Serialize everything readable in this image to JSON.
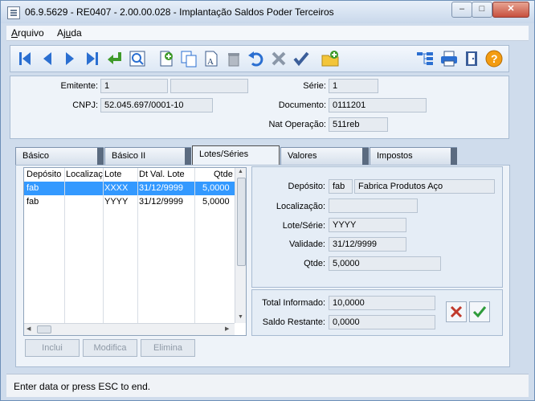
{
  "window": {
    "title": "06.9.5629 - RE0407 - 2.00.00.028 - Implantação Saldos Poder Terceiros",
    "controls": {
      "minimize": "–",
      "maximize": "□",
      "close": "✕"
    }
  },
  "menu": {
    "items": [
      {
        "u": "A",
        "rest": "rquivo"
      },
      {
        "pre": "Aj",
        "u": "u",
        "rest": "da"
      }
    ]
  },
  "toolbar": {
    "buttons": [
      "first-icon",
      "previous-icon",
      "next-icon",
      "last-icon",
      "goto-icon",
      "search-icon",
      "add-icon",
      "copy-icon",
      "edit-icon",
      "delete-icon",
      "undo-icon",
      "cancel-icon",
      "save-icon",
      "new-folder-icon",
      "hierarchy-icon",
      "print-icon",
      "exit-icon",
      "help-icon"
    ]
  },
  "header": {
    "emitente_label": "Emitente:",
    "emitente_value": "1",
    "emitente_name": "",
    "cnpj_label": "CNPJ:",
    "cnpj_value": "52.045.697/0001-10",
    "serie_label": "Série:",
    "serie_value": "1",
    "documento_label": "Documento:",
    "documento_value": "0111201",
    "natop_label": "Nat Operação:",
    "natop_value": "511reb"
  },
  "tabs": [
    "Básico",
    "Básico II",
    "Lotes/Séries",
    "Valores",
    "Impostos"
  ],
  "grid": {
    "columns": [
      "Depósito",
      "Localizaçã",
      "Lote",
      "Dt Val. Lote",
      "Qtde"
    ],
    "rows": [
      {
        "deposito": "fab",
        "localizacao": "",
        "lote": "XXXX",
        "validade": "31/12/9999",
        "qtde": "5,0000",
        "selected": true
      },
      {
        "deposito": "fab",
        "localizacao": "",
        "lote": "YYYY",
        "validade": "31/12/9999",
        "qtde": "5,0000",
        "selected": false
      }
    ],
    "buttons": {
      "incluir": "Inclui",
      "modificar": "Modifica",
      "eliminar": "Elimina"
    }
  },
  "detail": {
    "deposito_label": "Depósito:",
    "deposito_code": "fab",
    "deposito_name": "Fabrica Produtos Aço",
    "localizacao_label": "Localização:",
    "localizacao_value": "",
    "lote_label": "Lote/Série:",
    "lote_value": "YYYY",
    "validade_label": "Validade:",
    "validade_value": "31/12/9999",
    "qtde_label": "Qtde:",
    "qtde_value": "5,0000"
  },
  "totals": {
    "informado_label": "Total Informado:",
    "informado_value": "10,0000",
    "restante_label": "Saldo Restante:",
    "restante_value": "0,0000"
  },
  "status": {
    "text": "Enter data or press ESC to end."
  }
}
